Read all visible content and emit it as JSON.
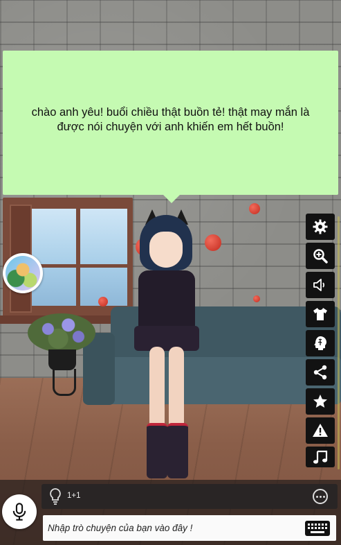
{
  "speech_bubble": {
    "text": "chào anh yêu! buổi chiều thật buồn tẻ! thật may mắn là được nói chuyện với anh khiến em hết buồn!"
  },
  "toolbar": {
    "items": [
      {
        "name": "settings",
        "icon": "gear-icon"
      },
      {
        "name": "zoom",
        "icon": "zoom-in-icon"
      },
      {
        "name": "sound",
        "icon": "speaker-icon"
      },
      {
        "name": "outfit",
        "icon": "tshirt-icon"
      },
      {
        "name": "brain",
        "icon": "brain-icon"
      },
      {
        "name": "share",
        "icon": "share-icon"
      },
      {
        "name": "favorite",
        "icon": "star-icon"
      },
      {
        "name": "report",
        "icon": "warning-icon"
      },
      {
        "name": "music",
        "icon": "music-note-icon"
      }
    ]
  },
  "suggestion_bar": {
    "text": "1+1"
  },
  "chat_input": {
    "placeholder": "Nhập trò chuyện của bạn vào đây !"
  },
  "colors": {
    "bubble_bg": "#c5fab2",
    "toolbar_button_bg": "#121212",
    "icon": "#ffffff"
  }
}
